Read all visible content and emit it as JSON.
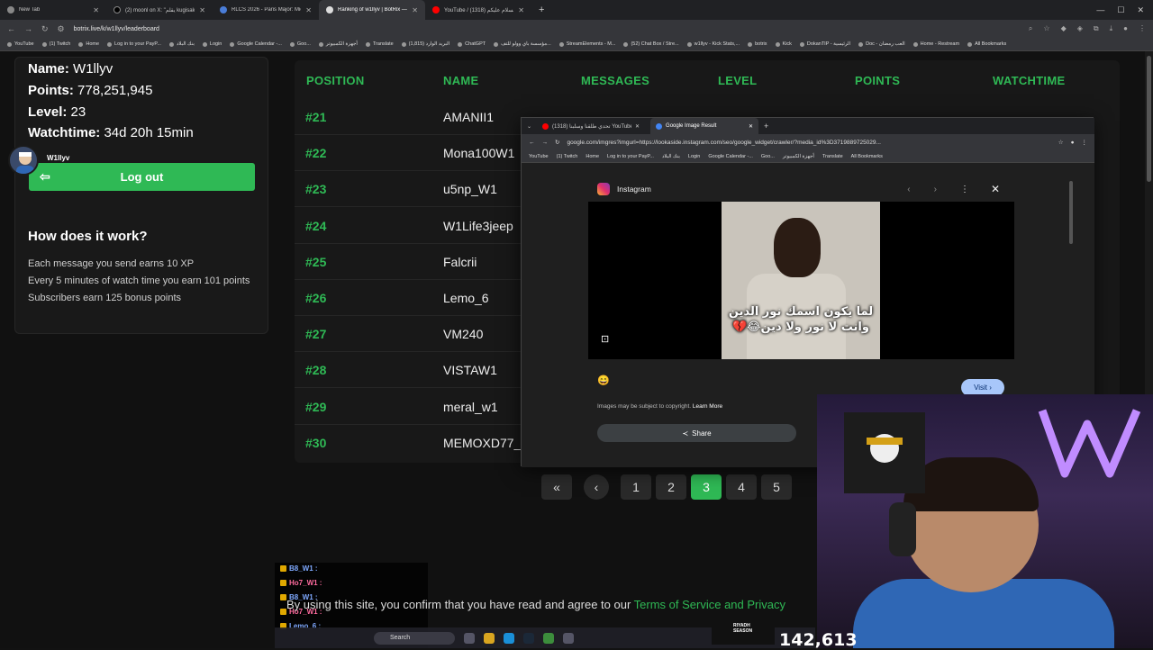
{
  "browser": {
    "tabs": [
      {
        "title": "New Tab"
      },
      {
        "title": "(2) moonl on X: \"يقلم kugisaki ...\""
      },
      {
        "title": "RLCS 2026 - Paris Major: Middle..."
      },
      {
        "title": "Ranking of w1llyv | BotRix — Cl..."
      },
      {
        "title": "YouTube / تحدي السلام عليكم (1318)"
      }
    ],
    "url": "botrix.live/k/w1llyv/leaderboard",
    "bookmarks": [
      "YouTube",
      "(1) Twitch",
      "Home",
      "Log in to your PayP...",
      "بنك البلاد",
      "Login",
      "Google Calendar -...",
      "Goo...",
      "أجهزة الكمبيوتر",
      "Translate",
      "البريد الوارد (1,815)",
      "ChatGPT",
      "مؤسسة باي وولو للتف...",
      "StreamElements - M...",
      "(52) Chat Box / Stre...",
      "w1llyv - Kick Stats,...",
      "botrix",
      "Kick",
      "DokanTIP - الرئيسية",
      "Doc - العب رمضان",
      "Home - Restream",
      "All Bookmarks"
    ]
  },
  "user": {
    "name_label": "Name:",
    "name": "W1llyv",
    "points_label": "Points:",
    "points": "778,251,945",
    "level_label": "Level:",
    "level": "23",
    "watchtime_label": "Watchtime:",
    "watchtime": "34d 20h 15min",
    "avatar_name": "W1llyv",
    "logout": "Log out"
  },
  "how": {
    "title": "How does it work?",
    "lines": [
      "Each message you send earns 10 XP",
      "Every 5 minutes of watch time you earn 101 points",
      "Subscribers earn 125 bonus points"
    ]
  },
  "table": {
    "headers": [
      "POSITION",
      "NAME",
      "MESSAGES",
      "LEVEL",
      "POINTS",
      "WATCHTIME"
    ],
    "rows": [
      {
        "pos": "#21",
        "name": "AMANII1"
      },
      {
        "pos": "#22",
        "name": "Mona100W1"
      },
      {
        "pos": "#23",
        "name": "u5np_W1"
      },
      {
        "pos": "#24",
        "name": "W1Life3jeep"
      },
      {
        "pos": "#25",
        "name": "Falcrii"
      },
      {
        "pos": "#26",
        "name": "Lemo_6"
      },
      {
        "pos": "#27",
        "name": "VM240"
      },
      {
        "pos": "#28",
        "name": "VISTAW1"
      },
      {
        "pos": "#29",
        "name": "meral_w1"
      },
      {
        "pos": "#30",
        "name": "MEMOXD77_W"
      }
    ]
  },
  "pagination": {
    "first": "«",
    "prev": "‹",
    "pages": [
      "1",
      "2",
      "3",
      "4",
      "5"
    ],
    "current": "3"
  },
  "popup": {
    "tabs": [
      "(1318) ‏تحدي طلقنا وسلبنا YouTube",
      "Google Image Result"
    ],
    "url": "google.com/imgres?imgurl=https://lookaside.instagram.com/seo/google_widget/crawler/?media_id%3D3719889725029...",
    "bookmarks": [
      "YouTube",
      "(1) Twitch",
      "Home",
      "Log in to your PayP...",
      "بنك البلاد",
      "Login",
      "Google Calendar -...",
      "Goo...",
      "أجهزة الكمبيوتر",
      "Translate",
      "All Bookmarks"
    ],
    "source": "Instagram",
    "meme_line1": "لما يكون اسمك نور الدين",
    "meme_line2": "وانت لا نور ولا دين😂💔",
    "visit": "Visit ›",
    "copyright": "Images may be subject to copyright.",
    "learn_more": "Learn More",
    "share": "Share"
  },
  "chat": [
    {
      "user": "B8_W1 :"
    },
    {
      "user": "Ho7_W1 :"
    },
    {
      "user": "B8_W1 :"
    },
    {
      "user": "Ho7_W1 :"
    },
    {
      "user": "Lemo_6 :"
    }
  ],
  "tos": {
    "text": "By using this site, you confirm that you have read and agree to our ",
    "link": "Terms of Service and Privacy"
  },
  "taskbar": {
    "search": "Search"
  },
  "stream": {
    "viewers": "142,613",
    "sponsor": "RIYADH SEASON"
  },
  "colors": {
    "accent": "#2fb955",
    "background": "#111111",
    "card": "#191919"
  }
}
